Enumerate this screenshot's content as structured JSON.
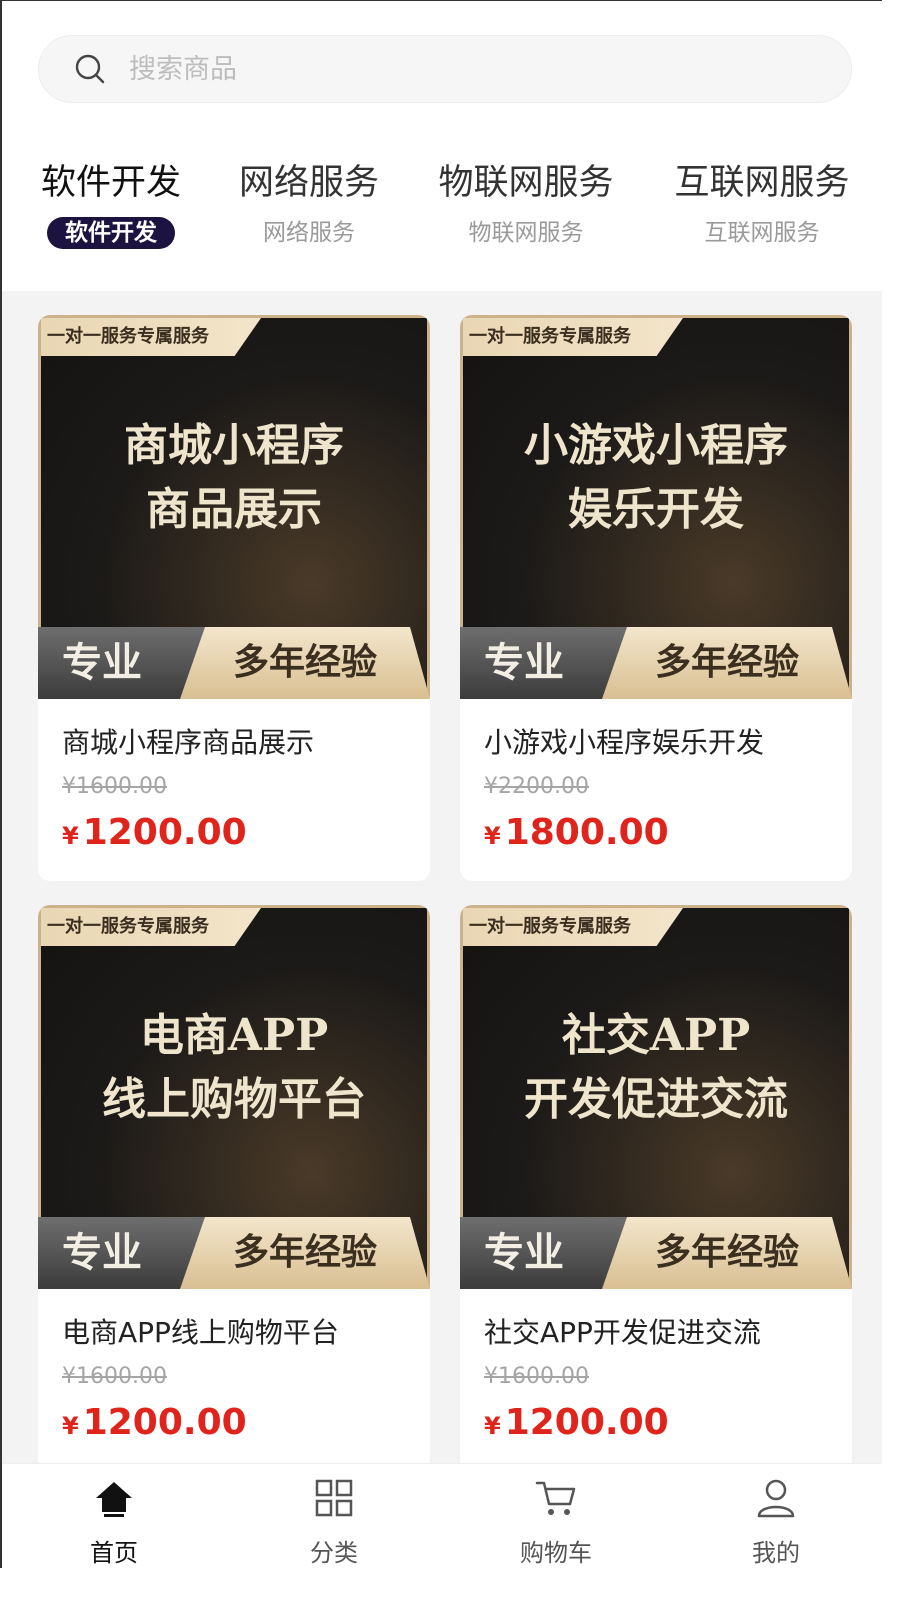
{
  "search": {
    "placeholder": "搜索商品"
  },
  "tabs": [
    {
      "label": "软件开发",
      "sub": "软件开发",
      "active": true
    },
    {
      "label": "网络服务",
      "sub": "网络服务",
      "active": false
    },
    {
      "label": "物联网服务",
      "sub": "物联网服务",
      "active": false
    },
    {
      "label": "互联网服务",
      "sub": "互联网服务",
      "active": false
    }
  ],
  "products": [
    {
      "ribbon": "一对一服务专属服务",
      "banner_line1": "商城小程序",
      "banner_line2": "商品展示",
      "badge_left": "专业",
      "badge_right": "多年经验",
      "name": "商城小程序商品展示",
      "original_price": "¥1600.00",
      "currency": "¥",
      "price": "1200.00"
    },
    {
      "ribbon": "一对一服务专属服务",
      "banner_line1": "小游戏小程序",
      "banner_line2": "娱乐开发",
      "badge_left": "专业",
      "badge_right": "多年经验",
      "name": "小游戏小程序娱乐开发",
      "original_price": "¥2200.00",
      "currency": "¥",
      "price": "1800.00"
    },
    {
      "ribbon": "一对一服务专属服务",
      "banner_line1": "电商APP",
      "banner_line2": "线上购物平台",
      "badge_left": "专业",
      "badge_right": "多年经验",
      "name": "电商APP线上购物平台",
      "original_price": "¥1600.00",
      "currency": "¥",
      "price": "1200.00"
    },
    {
      "ribbon": "一对一服务专属服务",
      "banner_line1": "社交APP",
      "banner_line2": "开发促进交流",
      "badge_left": "专业",
      "badge_right": "多年经验",
      "name": "社交APP开发促进交流",
      "original_price": "¥1600.00",
      "currency": "¥",
      "price": "1200.00"
    }
  ],
  "tabbar": [
    {
      "label": "首页",
      "icon": "home-icon",
      "active": true
    },
    {
      "label": "分类",
      "icon": "grid-icon",
      "active": false
    },
    {
      "label": "购物车",
      "icon": "cart-icon",
      "active": false
    },
    {
      "label": "我的",
      "icon": "user-icon",
      "active": false
    }
  ],
  "colors": {
    "accent_price": "#e0231b",
    "active_tab_badge": "#1c1340",
    "gold": "#cbb28a"
  }
}
